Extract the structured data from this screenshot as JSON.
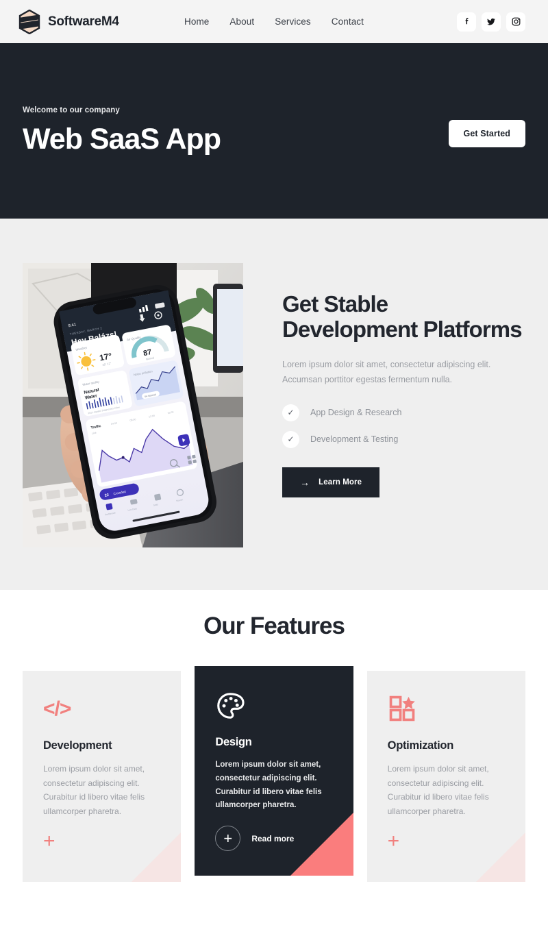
{
  "header": {
    "brand": {
      "name": "SoftwareM4",
      "logo_icon": "hexagon-logo-icon"
    },
    "nav": [
      {
        "label": "Home"
      },
      {
        "label": "About"
      },
      {
        "label": "Services"
      },
      {
        "label": "Contact"
      }
    ],
    "social": [
      {
        "icon": "facebook-icon",
        "name": "Facebook"
      },
      {
        "icon": "twitter-icon",
        "name": "Twitter"
      },
      {
        "icon": "instagram-icon",
        "name": "Instagram"
      }
    ],
    "background_color": "#f4f4f4"
  },
  "hero": {
    "eyebrow": "Welcome to our company",
    "title": "Web SaaS App",
    "cta_label": "Get Started",
    "background_color": "#1e232b",
    "cta_background": "#ffffff"
  },
  "about": {
    "photo_alt": "Hand holding a smartphone showing a dashboard app in front of a desktop workspace",
    "photo_app": {
      "greeting": "Hey Balázs!",
      "date_label": "TUESDAY, MARCH 2",
      "status_time": "9:41",
      "weather_card_label": "Weather",
      "temperature": "17°",
      "temp_range": "18° 12°",
      "air_quality_label": "Air Quality",
      "air_quality_value": "87",
      "air_quality_status": "Normal",
      "water_quality_label": "Water quality",
      "water_quality_value": "Natural Water",
      "noise_label": "Noise pollution",
      "traffic_label": "Traffic",
      "badge_value": "22"
    },
    "title": "Get Stable Development Platforms",
    "description": "Lorem ipsum dolor sit amet, consectetur adipiscing elit. Accumsan porttitor egestas fermentum nulla.",
    "checklist": [
      {
        "icon": "check-icon",
        "label": "App Design & Research"
      },
      {
        "icon": "check-icon",
        "label": "Development & Testing"
      }
    ],
    "cta_label": "Learn More",
    "cta_icon": "arrow-right-icon",
    "background_color": "#efefef"
  },
  "features": {
    "title": "Our Features",
    "cards": [
      {
        "icon": "code-brackets-icon",
        "title": "Development",
        "text": "Lorem ipsum dolor sit amet, consectetur adipiscing elit. Curabitur id libero vitae felis ullamcorper pharetra.",
        "action_icon": "plus-icon",
        "theme": "light",
        "corner_color": "#f6e5e4"
      },
      {
        "icon": "palette-icon",
        "title": "Design",
        "text": "Lorem ipsum dolor sit amet, consectetur adipiscing elit. Curabitur id libero vitae felis ullamcorper pharetra.",
        "action_label": "Read more",
        "action_icon": "plus-circle-icon",
        "theme": "dark",
        "corner_color": "#fa7d7d"
      },
      {
        "icon": "grid-star-icon",
        "title": "Optimization",
        "text": "Lorem ipsum dolor sit amet, consectetur adipiscing elit. Curabitur id libero vitae felis ullamcorper pharetra.",
        "action_icon": "plus-icon",
        "theme": "light",
        "corner_color": "#f6e5e4"
      }
    ]
  },
  "colors": {
    "dark": "#1e232b",
    "accent_coral": "#f1807e",
    "accent_coral_strong": "#fa7d7d",
    "muted_text": "#9a9da3",
    "light_gray": "#efefef"
  }
}
